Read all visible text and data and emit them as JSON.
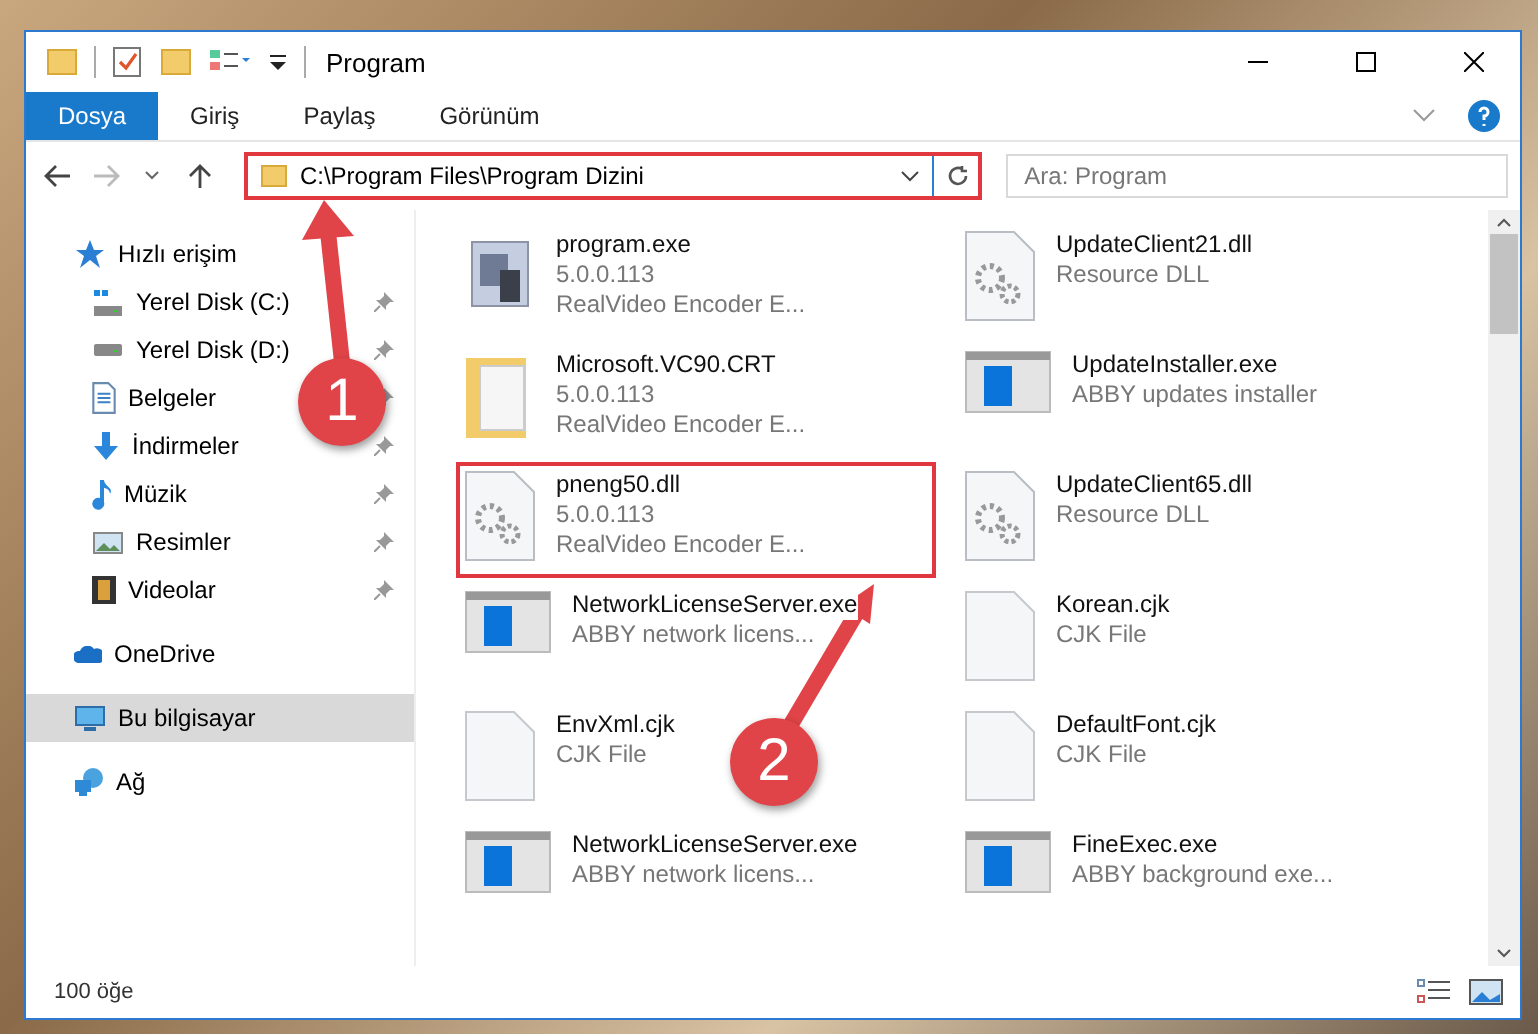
{
  "window": {
    "title": "Program"
  },
  "ribbon_tabs": [
    {
      "label": "Dosya",
      "selected": true
    },
    {
      "label": "Giriş",
      "selected": false
    },
    {
      "label": "Paylaş",
      "selected": false
    },
    {
      "label": "Görünüm",
      "selected": false
    }
  ],
  "address_bar": {
    "path": "C:\\Program Files\\Program Dizini",
    "highlighted": true
  },
  "search": {
    "placeholder": "Ara: Program"
  },
  "sidebar": {
    "items": [
      {
        "label": "Hızlı erişim",
        "kind": "star",
        "selected": false,
        "children": [
          {
            "label": "Yerel Disk (C:)",
            "kind": "disk-win",
            "selected": false
          },
          {
            "label": "Yerel Disk (D:)",
            "kind": "disk",
            "selected": false
          },
          {
            "label": "Belgeler",
            "kind": "document",
            "selected": false
          },
          {
            "label": "İndirmeler",
            "kind": "download",
            "selected": false
          },
          {
            "label": "Müzik",
            "kind": "music",
            "selected": false
          },
          {
            "label": "Resimler",
            "kind": "picture",
            "selected": false
          },
          {
            "label": "Videolar",
            "kind": "film",
            "selected": false
          }
        ]
      },
      {
        "label": "OneDrive",
        "kind": "cloud",
        "selected": false
      },
      {
        "label": "Bu bilgisayar",
        "kind": "computer",
        "selected": true
      },
      {
        "label": "Ağ",
        "kind": "network",
        "selected": false
      }
    ]
  },
  "files": [
    {
      "name": "program.exe",
      "kind": "program",
      "details": [
        "5.0.0.113",
        "RealVideo Encoder E..."
      ],
      "highlighted": false
    },
    {
      "name": "UpdateClient21.dll",
      "kind": "dll",
      "details": [
        "Resource DLL"
      ],
      "highlighted": false
    },
    {
      "name": "Microsoft.VC90.CRT",
      "kind": "folder",
      "details": [
        "5.0.0.113",
        "RealVideo Encoder E..."
      ],
      "highlighted": false
    },
    {
      "name": "UpdateInstaller.exe",
      "kind": "exe",
      "details": [
        "ABBY updates installer"
      ],
      "highlighted": false
    },
    {
      "name": "pneng50.dll",
      "kind": "dll",
      "details": [
        "5.0.0.113",
        "RealVideo Encoder E..."
      ],
      "highlighted": true
    },
    {
      "name": "UpdateClient65.dll",
      "kind": "dll",
      "details": [
        "Resource DLL"
      ],
      "highlighted": false
    },
    {
      "name": "NetworkLicenseServer.exe",
      "kind": "exe",
      "details": [
        "ABBY network licens..."
      ],
      "highlighted": false
    },
    {
      "name": "Korean.cjk",
      "kind": "file",
      "details": [
        "CJK File"
      ],
      "highlighted": false
    },
    {
      "name": "EnvXml.cjk",
      "kind": "file",
      "details": [
        "CJK File"
      ],
      "highlighted": false
    },
    {
      "name": "DefaultFont.cjk",
      "kind": "file",
      "details": [
        "CJK File"
      ],
      "highlighted": false
    },
    {
      "name": "NetworkLicenseServer.exe",
      "kind": "exe",
      "details": [
        "ABBY network licens..."
      ],
      "highlighted": false
    },
    {
      "name": "FineExec.exe",
      "kind": "exe",
      "details": [
        "ABBY background exe..."
      ],
      "highlighted": false
    }
  ],
  "status_bar": {
    "count": "100 öğe"
  },
  "annotations": [
    {
      "number": "1"
    },
    {
      "number": "2"
    }
  ]
}
